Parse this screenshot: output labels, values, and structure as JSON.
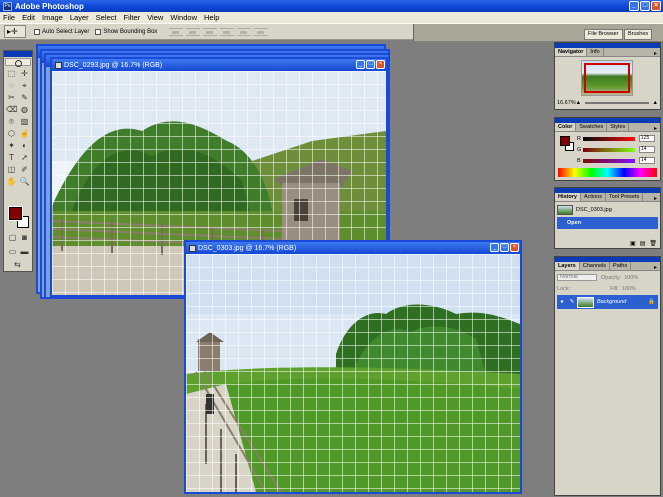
{
  "app": {
    "title": "Adobe Photoshop",
    "icon": "Ps"
  },
  "window_controls": {
    "minimize": "_",
    "maximize": "□",
    "close": "×"
  },
  "menu": [
    "File",
    "Edit",
    "Image",
    "Layer",
    "Select",
    "Filter",
    "View",
    "Window",
    "Help"
  ],
  "options": {
    "tool_preset_icon": "move-tool-icon",
    "tool_glyph": "▸✛",
    "auto_select_layer": "Auto Select Layer",
    "show_bounding_box": "Show Bounding Box"
  },
  "palette_well": {
    "tabs": [
      "File Browser",
      "Brushes"
    ]
  },
  "tools": [
    "⬚",
    "✛",
    "◌",
    "⌖",
    "✂",
    "✎",
    "⌫",
    "◍",
    "⌾",
    "▨",
    "⬡",
    "☝",
    "✦",
    "◐",
    "T",
    "➚",
    "◫",
    "✐",
    "✋",
    "🔍"
  ],
  "documents": {
    "back": {
      "title": "DSC_0293.jpg @ 16.7% (RGB)"
    },
    "front": {
      "title": "DSC_0303.jpg @ 16.7% (RGB)"
    }
  },
  "navigator": {
    "tabs": [
      "Navigator",
      "Info"
    ],
    "zoom": "16.67%",
    "menu_glyph": "▸"
  },
  "color": {
    "tabs": [
      "Color",
      "Swatches",
      "Styles"
    ],
    "channels": [
      {
        "label": "R",
        "value": "125"
      },
      {
        "label": "G",
        "value": "14"
      },
      {
        "label": "B",
        "value": "14"
      }
    ],
    "foreground": "#840000",
    "background": "#ffffff"
  },
  "history": {
    "tabs": [
      "History",
      "Actions",
      "Tool Presets"
    ],
    "snapshot": "DSC_0303.jpg",
    "selected_step": "Open"
  },
  "layers": {
    "tabs": [
      "Layers",
      "Channels",
      "Paths"
    ],
    "blend_mode": "Normal",
    "opacity_label": "Opacity:",
    "opacity": "100%",
    "lock_label": "Lock:",
    "fill_label": "Fill:",
    "fill": "100%",
    "layer_name": "Background",
    "eye": "●",
    "brush": "✎",
    "lock_glyph": "🔒"
  }
}
